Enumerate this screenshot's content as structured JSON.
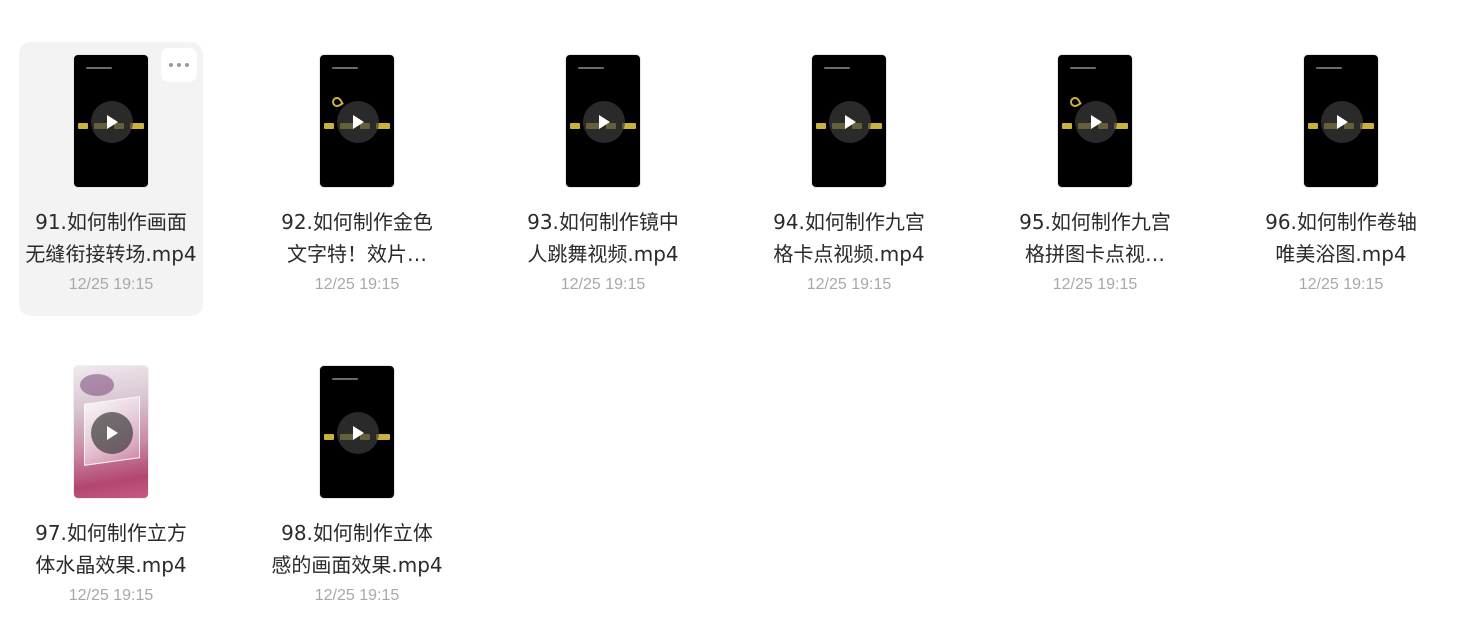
{
  "files": [
    {
      "title_line1": "91.如何制作画面",
      "title_line2": "无缝衔接转场.mp4",
      "date": "12/25 19:15",
      "thumbnail": "black-video",
      "selected": true
    },
    {
      "title_line1": "92.如何制作金色",
      "title_line2": "文字特！效片…",
      "date": "12/25 19:15",
      "thumbnail": "black-video"
    },
    {
      "title_line1": "93.如何制作镜中",
      "title_line2": "人跳舞视频.mp4",
      "date": "12/25 19:15",
      "thumbnail": "black-video"
    },
    {
      "title_line1": "94.如何制作九宫",
      "title_line2": "格卡点视频.mp4",
      "date": "12/25 19:15",
      "thumbnail": "black-video"
    },
    {
      "title_line1": "95.如何制作九宫",
      "title_line2": "格拼图卡点视…",
      "date": "12/25 19:15",
      "thumbnail": "black-video"
    },
    {
      "title_line1": "96.如何制作卷轴",
      "title_line2": "唯美浴图.mp4",
      "date": "12/25 19:15",
      "thumbnail": "black-video"
    },
    {
      "title_line1": "97.如何制作立方",
      "title_line2": "体水晶效果.mp4",
      "date": "12/25 19:15",
      "thumbnail": "crystal-video"
    },
    {
      "title_line1": "98.如何制作立体",
      "title_line2": "感的画面效果.mp4",
      "date": "12/25 19:15",
      "thumbnail": "black-video"
    }
  ],
  "icons": {
    "play": "play-icon",
    "more": "more-options-icon"
  },
  "colors": {
    "selected_background": "#f3f3f3",
    "title_text": "#2a2a2a",
    "date_text": "#a8a8a8",
    "caption_gold": "#c9b23a"
  }
}
